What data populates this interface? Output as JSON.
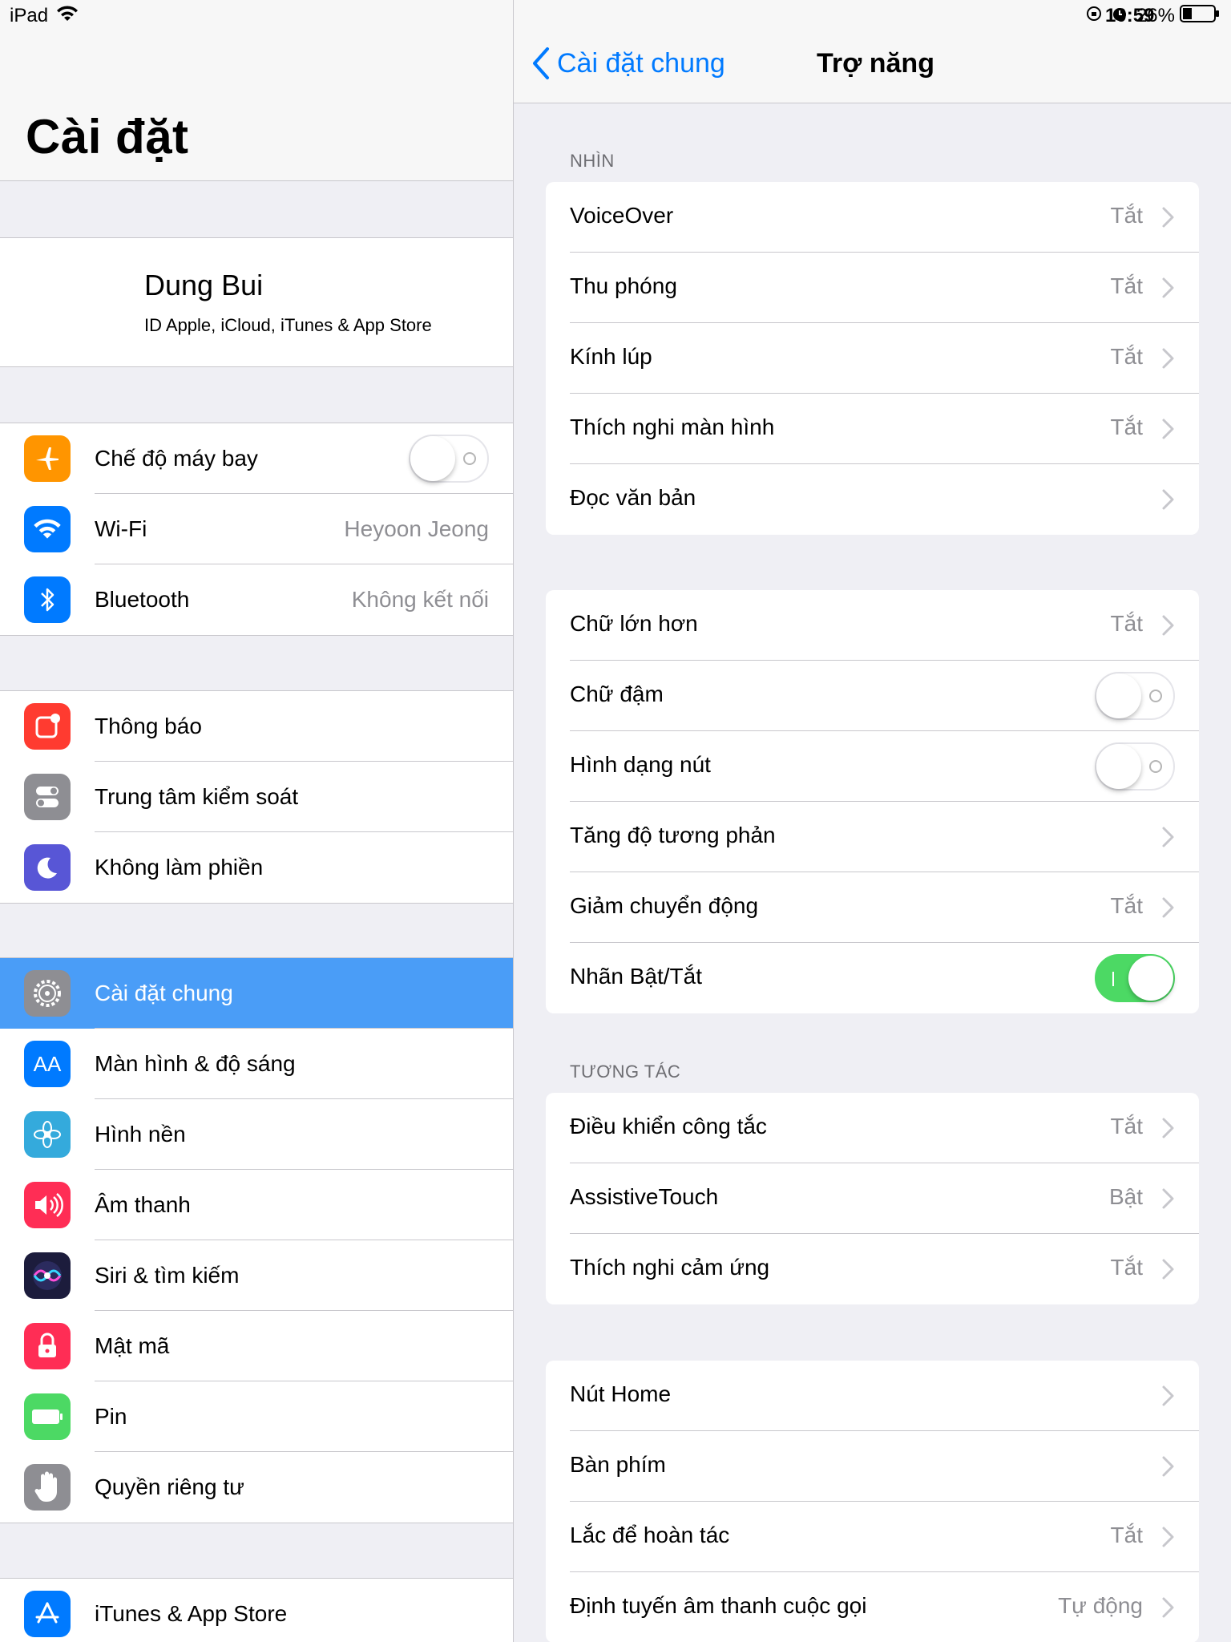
{
  "status": {
    "device": "iPad",
    "time": "10:59",
    "battery": "26%"
  },
  "left": {
    "title": "Cài đặt",
    "profile": {
      "name": "Dung Bui",
      "subtitle": "ID Apple, iCloud, iTunes & App Store"
    },
    "g1": [
      {
        "label": "Chế độ máy bay",
        "icon": "airplane-icon",
        "color": "#ff9500",
        "toggle": "off"
      },
      {
        "label": "Wi-Fi",
        "icon": "wifi-icon",
        "color": "#007aff",
        "value": "Heyoon Jeong"
      },
      {
        "label": "Bluetooth",
        "icon": "bluetooth-icon",
        "color": "#007aff",
        "value": "Không kết nối"
      }
    ],
    "g2": [
      {
        "label": "Thông báo",
        "icon": "notifications-icon",
        "color": "#ff3b30"
      },
      {
        "label": "Trung tâm kiểm soát",
        "icon": "control-center-icon",
        "color": "#8e8e93"
      },
      {
        "label": "Không làm phiền",
        "icon": "moon-icon",
        "color": "#5856d6"
      }
    ],
    "g3": [
      {
        "label": "Cài đặt chung",
        "icon": "gear-icon",
        "color": "#8e8e93",
        "selected": true
      },
      {
        "label": "Màn hình & độ sáng",
        "icon": "display-icon",
        "color": "#007aff",
        "glyph": "AA"
      },
      {
        "label": "Hình nền",
        "icon": "wallpaper-icon",
        "color": "#34aadc"
      },
      {
        "label": "Âm thanh",
        "icon": "sound-icon",
        "color": "#ff2d55"
      },
      {
        "label": "Siri & tìm kiếm",
        "icon": "siri-icon",
        "color": "#1c1c3c"
      },
      {
        "label": "Mật mã",
        "icon": "lock-icon",
        "color": "#ff2d55"
      },
      {
        "label": "Pin",
        "icon": "battery-icon",
        "color": "#4cd964"
      },
      {
        "label": "Quyền riêng tư",
        "icon": "hand-icon",
        "color": "#8e8e93"
      }
    ],
    "g4": [
      {
        "label": "iTunes & App Store",
        "icon": "app-store-icon",
        "color": "#007aff"
      }
    ]
  },
  "right": {
    "back_label": "Cài đặt chung",
    "title": "Trợ năng",
    "sec1_header": "NHÌN",
    "card1": [
      {
        "label": "VoiceOver",
        "value": "Tắt",
        "chevron": true
      },
      {
        "label": "Thu phóng",
        "value": "Tắt",
        "chevron": true
      },
      {
        "label": "Kính lúp",
        "value": "Tắt",
        "chevron": true
      },
      {
        "label": "Thích nghi màn hình",
        "value": "Tắt",
        "chevron": true
      },
      {
        "label": "Đọc văn bản",
        "value": "",
        "chevron": true
      }
    ],
    "card2": [
      {
        "label": "Chữ lớn hơn",
        "value": "Tắt",
        "chevron": true
      },
      {
        "label": "Chữ đậm",
        "toggle": "off"
      },
      {
        "label": "Hình dạng nút",
        "toggle": "off"
      },
      {
        "label": "Tăng độ tương phản",
        "value": "",
        "chevron": true
      },
      {
        "label": "Giảm chuyển động",
        "value": "Tắt",
        "chevron": true
      },
      {
        "label": "Nhãn Bật/Tắt",
        "toggle": "on"
      }
    ],
    "sec3_header": "TƯƠNG TÁC",
    "card3": [
      {
        "label": "Điều khiển công tắc",
        "value": "Tắt",
        "chevron": true
      },
      {
        "label": "AssistiveTouch",
        "value": "Bật",
        "chevron": true
      },
      {
        "label": "Thích nghi cảm ứng",
        "value": "Tắt",
        "chevron": true
      }
    ],
    "card4": [
      {
        "label": "Nút Home",
        "value": "",
        "chevron": true
      },
      {
        "label": "Bàn phím",
        "value": "",
        "chevron": true
      },
      {
        "label": "Lắc để hoàn tác",
        "value": "Tắt",
        "chevron": true
      },
      {
        "label": "Định tuyến âm thanh cuộc gọi",
        "value": "Tự động",
        "chevron": true
      }
    ]
  }
}
